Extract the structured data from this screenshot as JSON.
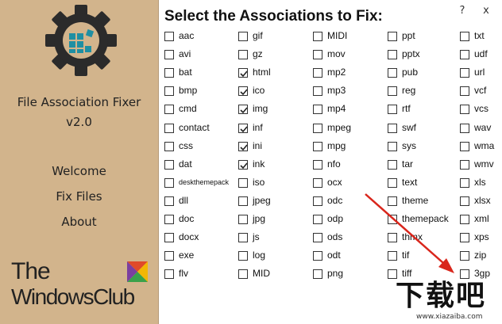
{
  "app": {
    "name": "File Association Fixer",
    "version": "v2.0",
    "heading": "Select the Associations to Fix:",
    "help_label": "?",
    "close_label": "x"
  },
  "nav": [
    {
      "label": "Welcome"
    },
    {
      "label": "Fix Files"
    },
    {
      "label": "About"
    }
  ],
  "brand": {
    "line1": "The",
    "line2": "WindowsClub"
  },
  "watermark": {
    "text": "下载吧",
    "url": "www.xiazaiba.com"
  },
  "colors": {
    "sidebar": "#d2b48c",
    "gear": "#2b2b2b",
    "gear_tiles": "#1f8fa3",
    "arrow": "#d9261c"
  },
  "associations": [
    [
      {
        "label": "aac",
        "checked": false
      },
      {
        "label": "avi",
        "checked": false
      },
      {
        "label": "bat",
        "checked": false
      },
      {
        "label": "bmp",
        "checked": false
      },
      {
        "label": "cmd",
        "checked": false
      },
      {
        "label": "contact",
        "checked": false
      },
      {
        "label": "css",
        "checked": false
      },
      {
        "label": "dat",
        "checked": false
      },
      {
        "label": "deskthemepack",
        "checked": false
      },
      {
        "label": "dll",
        "checked": false
      },
      {
        "label": "doc",
        "checked": false
      },
      {
        "label": "docx",
        "checked": false
      },
      {
        "label": "exe",
        "checked": false
      },
      {
        "label": "flv",
        "checked": false
      }
    ],
    [
      {
        "label": "gif",
        "checked": false
      },
      {
        "label": "gz",
        "checked": false
      },
      {
        "label": "html",
        "checked": true
      },
      {
        "label": "ico",
        "checked": true
      },
      {
        "label": "img",
        "checked": true
      },
      {
        "label": "inf",
        "checked": true
      },
      {
        "label": "ini",
        "checked": true
      },
      {
        "label": "ink",
        "checked": true
      },
      {
        "label": "iso",
        "checked": false
      },
      {
        "label": "jpeg",
        "checked": false
      },
      {
        "label": "jpg",
        "checked": false
      },
      {
        "label": "js",
        "checked": false
      },
      {
        "label": "log",
        "checked": false
      },
      {
        "label": "MID",
        "checked": false
      }
    ],
    [
      {
        "label": "MIDI",
        "checked": false
      },
      {
        "label": "mov",
        "checked": false
      },
      {
        "label": "mp2",
        "checked": false
      },
      {
        "label": "mp3",
        "checked": false
      },
      {
        "label": "mp4",
        "checked": false
      },
      {
        "label": "mpeg",
        "checked": false
      },
      {
        "label": "mpg",
        "checked": false
      },
      {
        "label": "nfo",
        "checked": false
      },
      {
        "label": "ocx",
        "checked": false
      },
      {
        "label": "odc",
        "checked": false
      },
      {
        "label": "odp",
        "checked": false
      },
      {
        "label": "ods",
        "checked": false
      },
      {
        "label": "odt",
        "checked": false
      },
      {
        "label": "png",
        "checked": false
      }
    ],
    [
      {
        "label": "ppt",
        "checked": false
      },
      {
        "label": "pptx",
        "checked": false
      },
      {
        "label": "pub",
        "checked": false
      },
      {
        "label": "reg",
        "checked": false
      },
      {
        "label": "rtf",
        "checked": false
      },
      {
        "label": "swf",
        "checked": false
      },
      {
        "label": "sys",
        "checked": false
      },
      {
        "label": "tar",
        "checked": false
      },
      {
        "label": "text",
        "checked": false
      },
      {
        "label": "theme",
        "checked": false
      },
      {
        "label": "themepack",
        "checked": false
      },
      {
        "label": "thmx",
        "checked": false
      },
      {
        "label": "tif",
        "checked": false
      },
      {
        "label": "tiff",
        "checked": false
      }
    ],
    [
      {
        "label": "txt",
        "checked": false
      },
      {
        "label": "udf",
        "checked": false
      },
      {
        "label": "url",
        "checked": false
      },
      {
        "label": "vcf",
        "checked": false
      },
      {
        "label": "vcs",
        "checked": false
      },
      {
        "label": "wav",
        "checked": false
      },
      {
        "label": "wma",
        "checked": false
      },
      {
        "label": "wmv",
        "checked": false
      },
      {
        "label": "xls",
        "checked": false
      },
      {
        "label": "xlsx",
        "checked": false
      },
      {
        "label": "xml",
        "checked": false
      },
      {
        "label": "xps",
        "checked": false
      },
      {
        "label": "zip",
        "checked": false
      },
      {
        "label": "3gp",
        "checked": false
      }
    ]
  ]
}
